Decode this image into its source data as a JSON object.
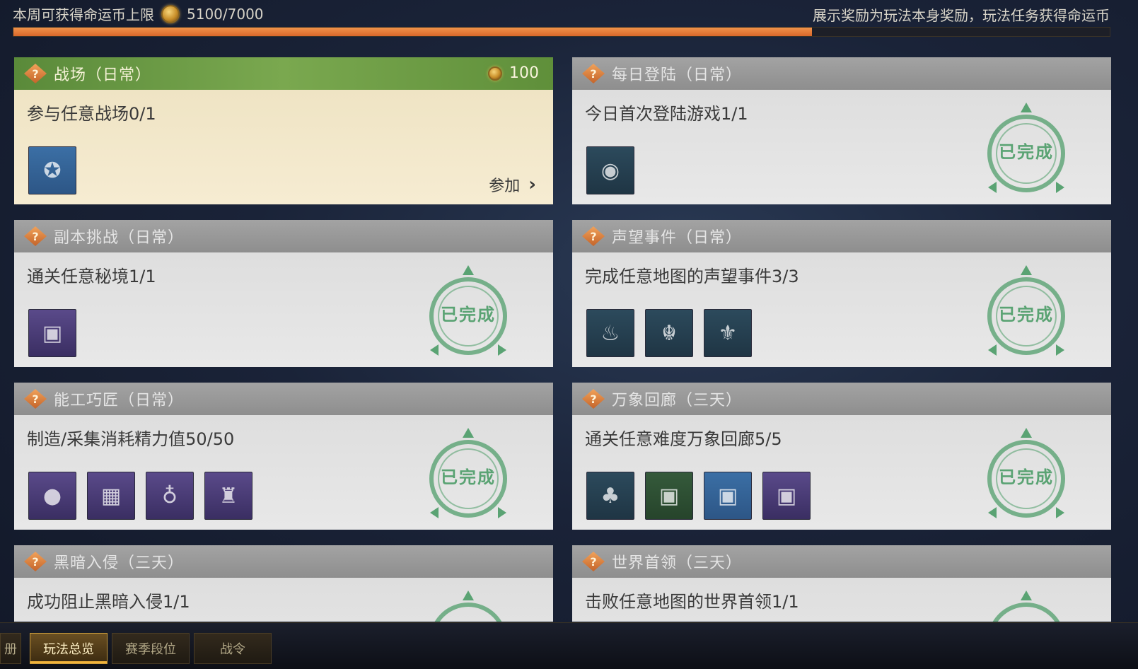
{
  "header": {
    "weekly_limit_label": "本周可获得命运币上限",
    "weekly_limit_value": "5100/7000",
    "note": "展示奖励为玩法本身奖励，玩法任务获得命运币",
    "progress_fraction": 0.7286,
    "coin_icon": "coin-icon"
  },
  "cards": [
    {
      "title": "战场（日常）",
      "task": "参与任意战场0/1",
      "reward": "100",
      "action": "参加",
      "status": ""
    },
    {
      "title": "每日登陆（日常）",
      "task": "今日首次登陆游戏1/1",
      "status": "已完成"
    },
    {
      "title": "副本挑战（日常）",
      "task": "通关任意秘境1/1",
      "status": "已完成"
    },
    {
      "title": "声望事件（日常）",
      "task": "完成任意地图的声望事件3/3",
      "status": "已完成"
    },
    {
      "title": "能工巧匠（日常）",
      "task": "制造/采集消耗精力值50/50",
      "status": "已完成"
    },
    {
      "title": "万象回廊（三天）",
      "task": "通关任意难度万象回廊5/5",
      "status": "已完成"
    },
    {
      "title": "黑暗入侵（三天）",
      "task": "成功阻止黑暗入侵1/1",
      "status": ""
    },
    {
      "title": "世界首领（三天）",
      "task": "击败任意地图的世界首领1/1",
      "status": ""
    }
  ],
  "bottom_tabs": [
    {
      "label": "册"
    },
    {
      "label": "玩法总览"
    },
    {
      "label": "赛季段位"
    },
    {
      "label": "战令"
    }
  ],
  "colors": {
    "accent_orange": "#e07a36",
    "active_header_green": "#6e9c47",
    "stamp_green": "#5aa373"
  }
}
